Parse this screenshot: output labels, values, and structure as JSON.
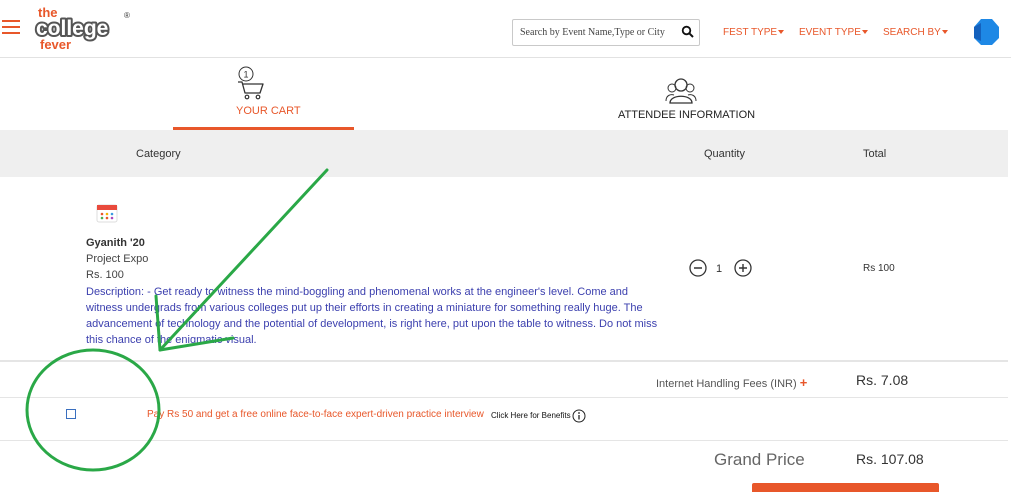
{
  "header": {
    "logo_lines": [
      "the",
      "college",
      "fever"
    ],
    "search": {
      "placeholder": "Search by Event Name,Type or City",
      "value": ""
    },
    "nav": [
      {
        "label": "FEST TYPE"
      },
      {
        "label": "EVENT TYPE"
      },
      {
        "label": "SEARCH BY"
      }
    ]
  },
  "steps": [
    {
      "badge": "1",
      "label": "YOUR CART",
      "active": true
    },
    {
      "label": "ATTENDEE INFORMATION",
      "active": false
    }
  ],
  "table": {
    "headers": {
      "category": "Category",
      "quantity": "Quantity",
      "total": "Total"
    }
  },
  "cart_item": {
    "name": "Gyanith '20",
    "category": "Project Expo",
    "price": "Rs. 100",
    "description": "Description: - Get ready to witness the mind-boggling and phenomenal works at the engineer's level. Come and witness undergrads from various colleges put up their efforts in creating a miniature for something really huge. The advancement of technology and the potential of development, is right here, put upon the table to witness. Do not miss this chance of the enigmatic visual.",
    "quantity": "1",
    "total": "Rs 100"
  },
  "fees": {
    "label": "Internet Handling Fees (INR)",
    "plus": "+",
    "value": "Rs. 7.08"
  },
  "promo": {
    "text": "Pay Rs 50 and get a free online face-to-face expert-driven practice interview",
    "link": "Click Here for Benefits",
    "checked": false
  },
  "grand": {
    "label": "Grand Price",
    "value": "Rs. 107.08"
  },
  "colors": {
    "accent": "#e8572a",
    "description": "#3b3fae",
    "annotation": "#2aa847",
    "avatar": "#1e88e5"
  }
}
